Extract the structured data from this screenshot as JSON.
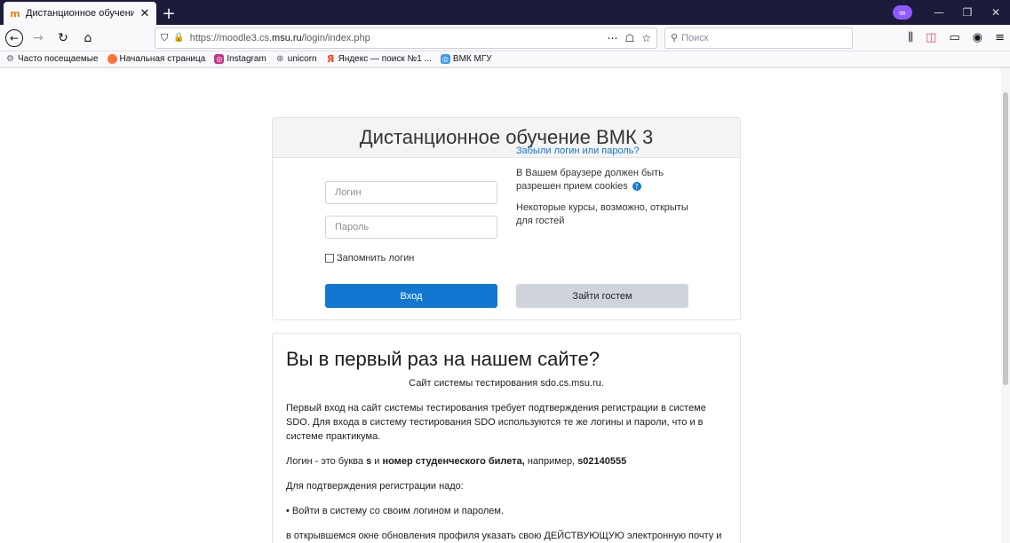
{
  "browser": {
    "tab_title": "Дистанционное обучение ВМК",
    "tab_close": "✕",
    "newtab": "+",
    "ext_badge": "∞",
    "url_prefix": "https://moodle3.cs.",
    "url_domain": "msu.ru",
    "url_path": "/login/index.php",
    "search_placeholder": "Поиск"
  },
  "bookmarks": [
    {
      "label": "Часто посещаемые",
      "icon": "gear-icon",
      "color": "#5b5b66"
    },
    {
      "label": "Начальная страница",
      "icon": "firefox-icon",
      "color": "#ff7139"
    },
    {
      "label": "Instagram",
      "icon": "instagram-icon",
      "color": "#c13584"
    },
    {
      "label": "unicorn",
      "icon": "globe-icon",
      "color": "#5b5b66"
    },
    {
      "label": "Яндекс — поиск №1 ...",
      "icon": "yandex-icon",
      "color": "#fc3f1d"
    },
    {
      "label": "ВМК МГУ",
      "icon": "vmk-icon",
      "color": "#3d9be9"
    }
  ],
  "login": {
    "title": "Дистанционное обучение ВМК 3",
    "username_placeholder": "Логин",
    "password_placeholder": "Пароль",
    "remember_label": "Запомнить логин",
    "login_button": "Вход",
    "forgot_link": "Забыли логин или пароль?",
    "cookies_text": "В Вашем браузере должен быть разрешен прием cookies",
    "guest_text": "Некоторые курсы, возможно, открыты для гостей",
    "guest_button": "Зайти гостем",
    "accent": "#1177d1"
  },
  "info": {
    "title": "Вы в первый раз на нашем сайте?",
    "subtitle": "Сайт системы тестирования   sdo.cs.msu.ru.",
    "p1": "Первый вход на сайт системы тестирования требует подтверждения регистрации в системе SDO. Для входа в систему тестирования SDO используются те же логины и пароли, что и в системе практикума.",
    "p2_a": "Логин - это буква ",
    "p2_s": "s",
    "p2_b": " и ",
    "p2_bold": "номер студенческого билета,",
    "p2_c": " например,  ",
    "p2_example": "s02140555",
    "p3": "Для подтверждения регистрации надо:",
    "bullet1": "• Войти в систему со своим  логином и паролем.",
    "p4": "в открывшемся окне обновления профиля указать свою ДЕЙСТВУЮЩУЮ электронную почту и"
  }
}
